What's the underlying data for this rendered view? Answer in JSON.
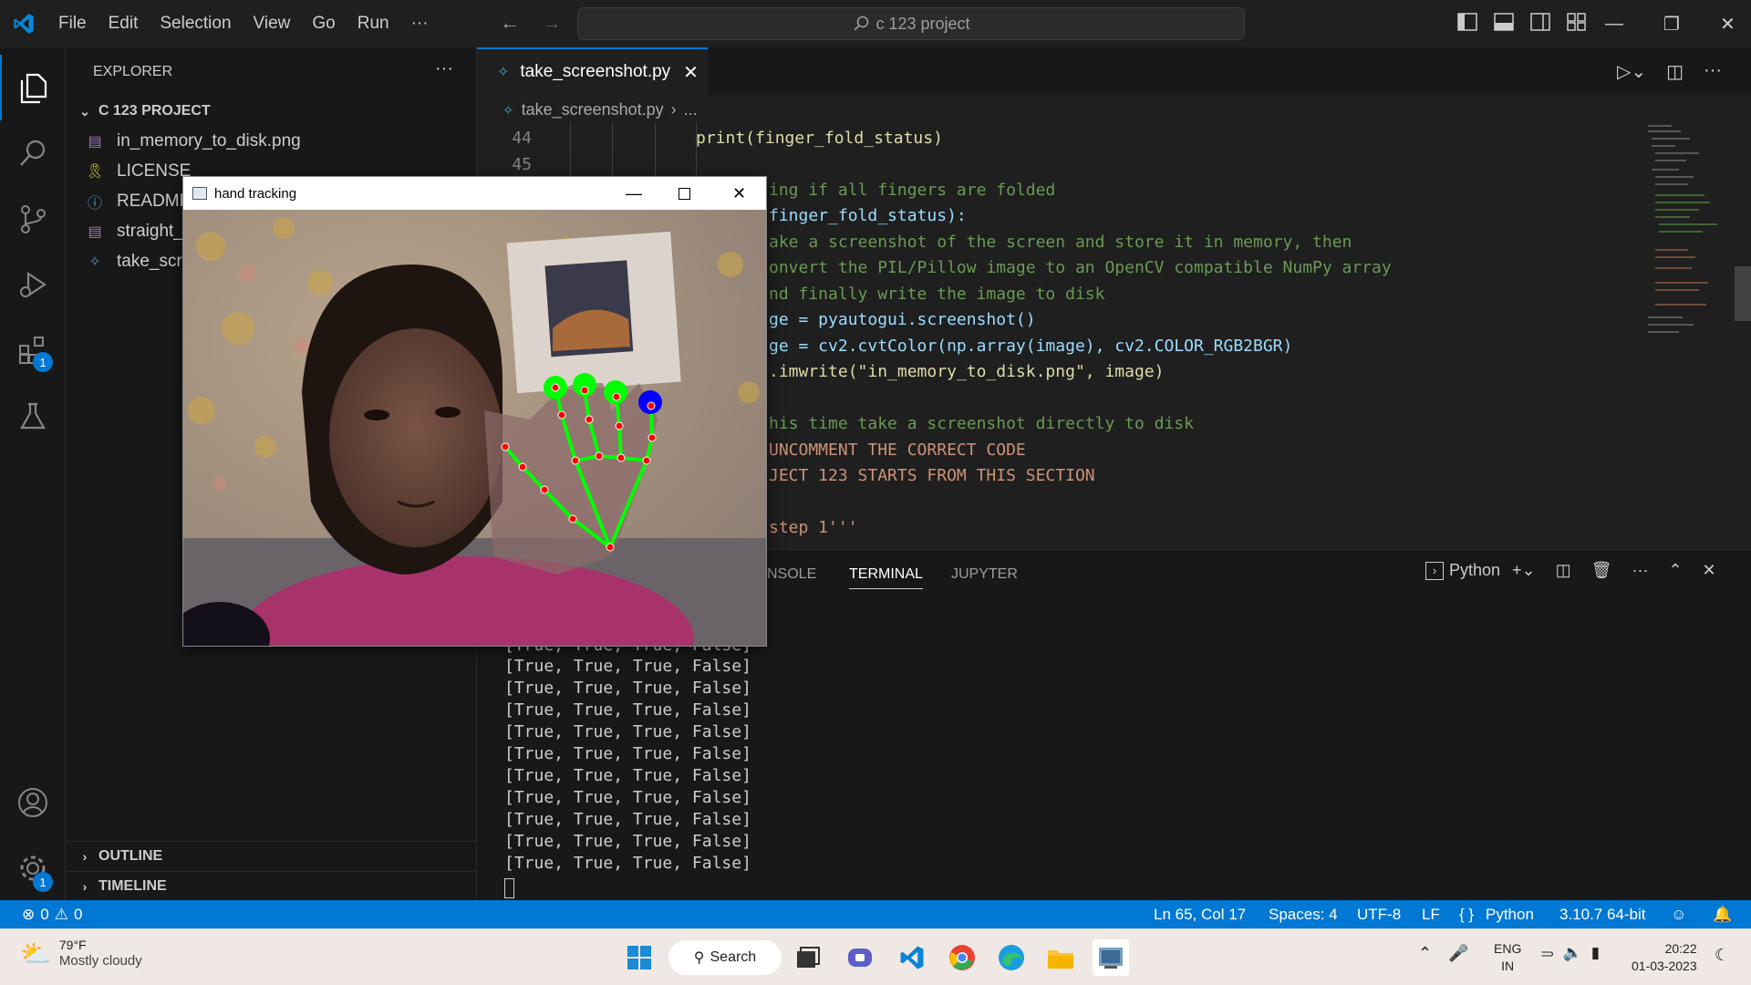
{
  "titlebar": {
    "menu": [
      "File",
      "Edit",
      "Selection",
      "View",
      "Go",
      "Run",
      "···"
    ],
    "search": "c 123 project",
    "window_buttons": [
      "minimize",
      "maximize",
      "close"
    ]
  },
  "sidebar": {
    "title": "EXPLORER",
    "more": "···",
    "project": "C 123 PROJECT",
    "files": [
      {
        "name": "in_memory_to_disk.png",
        "icon": "image-icon"
      },
      {
        "name": "LICENSE",
        "icon": "license-icon"
      },
      {
        "name": "README",
        "icon": "info-icon"
      },
      {
        "name": "straight_",
        "icon": "image-icon"
      },
      {
        "name": "take_scre",
        "icon": "python-icon"
      }
    ],
    "outline": "OUTLINE",
    "timeline": "TIMELINE"
  },
  "activity": {
    "extensions_badge": "1",
    "settings_badge": "1"
  },
  "editor": {
    "tab": "take_screenshot.py",
    "breadcrumb_file": "take_screenshot.py",
    "breadcrumb_rest": "...",
    "lines": [
      {
        "n": "44",
        "t": "print(finger_fold_status)"
      },
      {
        "n": "45",
        "t": ""
      },
      {
        "n": "",
        "t": "ing if all fingers are folded"
      },
      {
        "n": "",
        "t": "finger_fold_status):"
      },
      {
        "n": "",
        "t": "ake a screenshot of the screen and store it in memory, then"
      },
      {
        "n": "",
        "t": "onvert the PIL/Pillow image to an OpenCV compatible NumPy array"
      },
      {
        "n": "",
        "t": "nd finally write the image to disk"
      },
      {
        "n": "",
        "t": "ge = pyautogui.screenshot()"
      },
      {
        "n": "",
        "t": "ge = cv2.cvtColor(np.array(image), cv2.COLOR_RGB2BGR)"
      },
      {
        "n": "",
        "t": ".imwrite(\"in_memory_to_disk.png\", image)"
      },
      {
        "n": "",
        "t": ""
      },
      {
        "n": "",
        "t": "his time take a screenshot directly to disk"
      },
      {
        "n": "",
        "t": "UNCOMMENT THE CORRECT CODE"
      },
      {
        "n": "",
        "t": "JECT 123 STARTS FROM THIS SECTION"
      },
      {
        "n": "",
        "t": ""
      },
      {
        "n": "",
        "t": "step 1'''"
      }
    ]
  },
  "panel": {
    "tabs": [
      "NSOLE",
      "TERMINAL",
      "JUPYTER"
    ],
    "shell": "Python",
    "output_partial": "[True, True, True, False]",
    "output": [
      "[True, True, True, False]",
      "[True, True, True, False]",
      "[True, True, True, False]",
      "[True, True, True, False]",
      "[True, True, True, False]",
      "[True, True, True, False]",
      "[True, True, True, False]",
      "[True, True, True, False]",
      "[True, True, True, False]",
      "[True, True, True, False]"
    ]
  },
  "cv_window": {
    "title": "hand tracking"
  },
  "status": {
    "errors": "0",
    "warnings": "0",
    "position": "Ln 65, Col 17",
    "spaces": "Spaces: 4",
    "encoding": "UTF-8",
    "eol": "LF",
    "language": "Python",
    "interpreter": "3.10.7 64-bit"
  },
  "taskbar": {
    "weather_temp": "79°F",
    "weather_desc": "Mostly cloudy",
    "search": "Search",
    "lang1": "ENG",
    "lang2": "IN",
    "time": "20:22",
    "date": "01-03-2023"
  }
}
